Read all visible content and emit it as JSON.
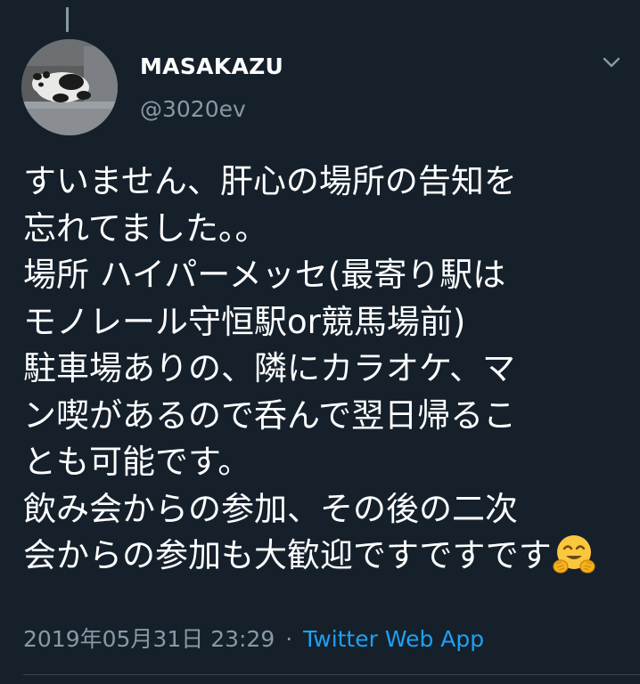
{
  "tweet": {
    "author": {
      "display_name": "MASAKAZU",
      "handle": "@3020ev",
      "avatar_icon": "panda-avatar-icon"
    },
    "menu_icon": "chevron-down-icon",
    "text_lines": [
      "すいません、肝心の場所の告知を",
      "忘れてました。。",
      "場所 ハイパーメッセ(最寄り駅は",
      "モノレール守恒駅or競馬場前)",
      "駐車場ありの、隣にカラオケ、マ",
      "ン喫があるので呑んで翌日帰るこ",
      "とも可能です。",
      "飲み会からの参加、その後の二次",
      "会からの参加も大歓迎ですですです"
    ],
    "emoji_icon": "hugging-face-emoji-icon",
    "timestamp": "2019年05月31日 23:29",
    "separator": "·",
    "source": "Twitter Web App"
  },
  "colors": {
    "background": "#15202b",
    "text_primary": "#ffffff",
    "text_secondary": "#8899a6",
    "link": "#1da1f2",
    "divider": "#38444d"
  }
}
